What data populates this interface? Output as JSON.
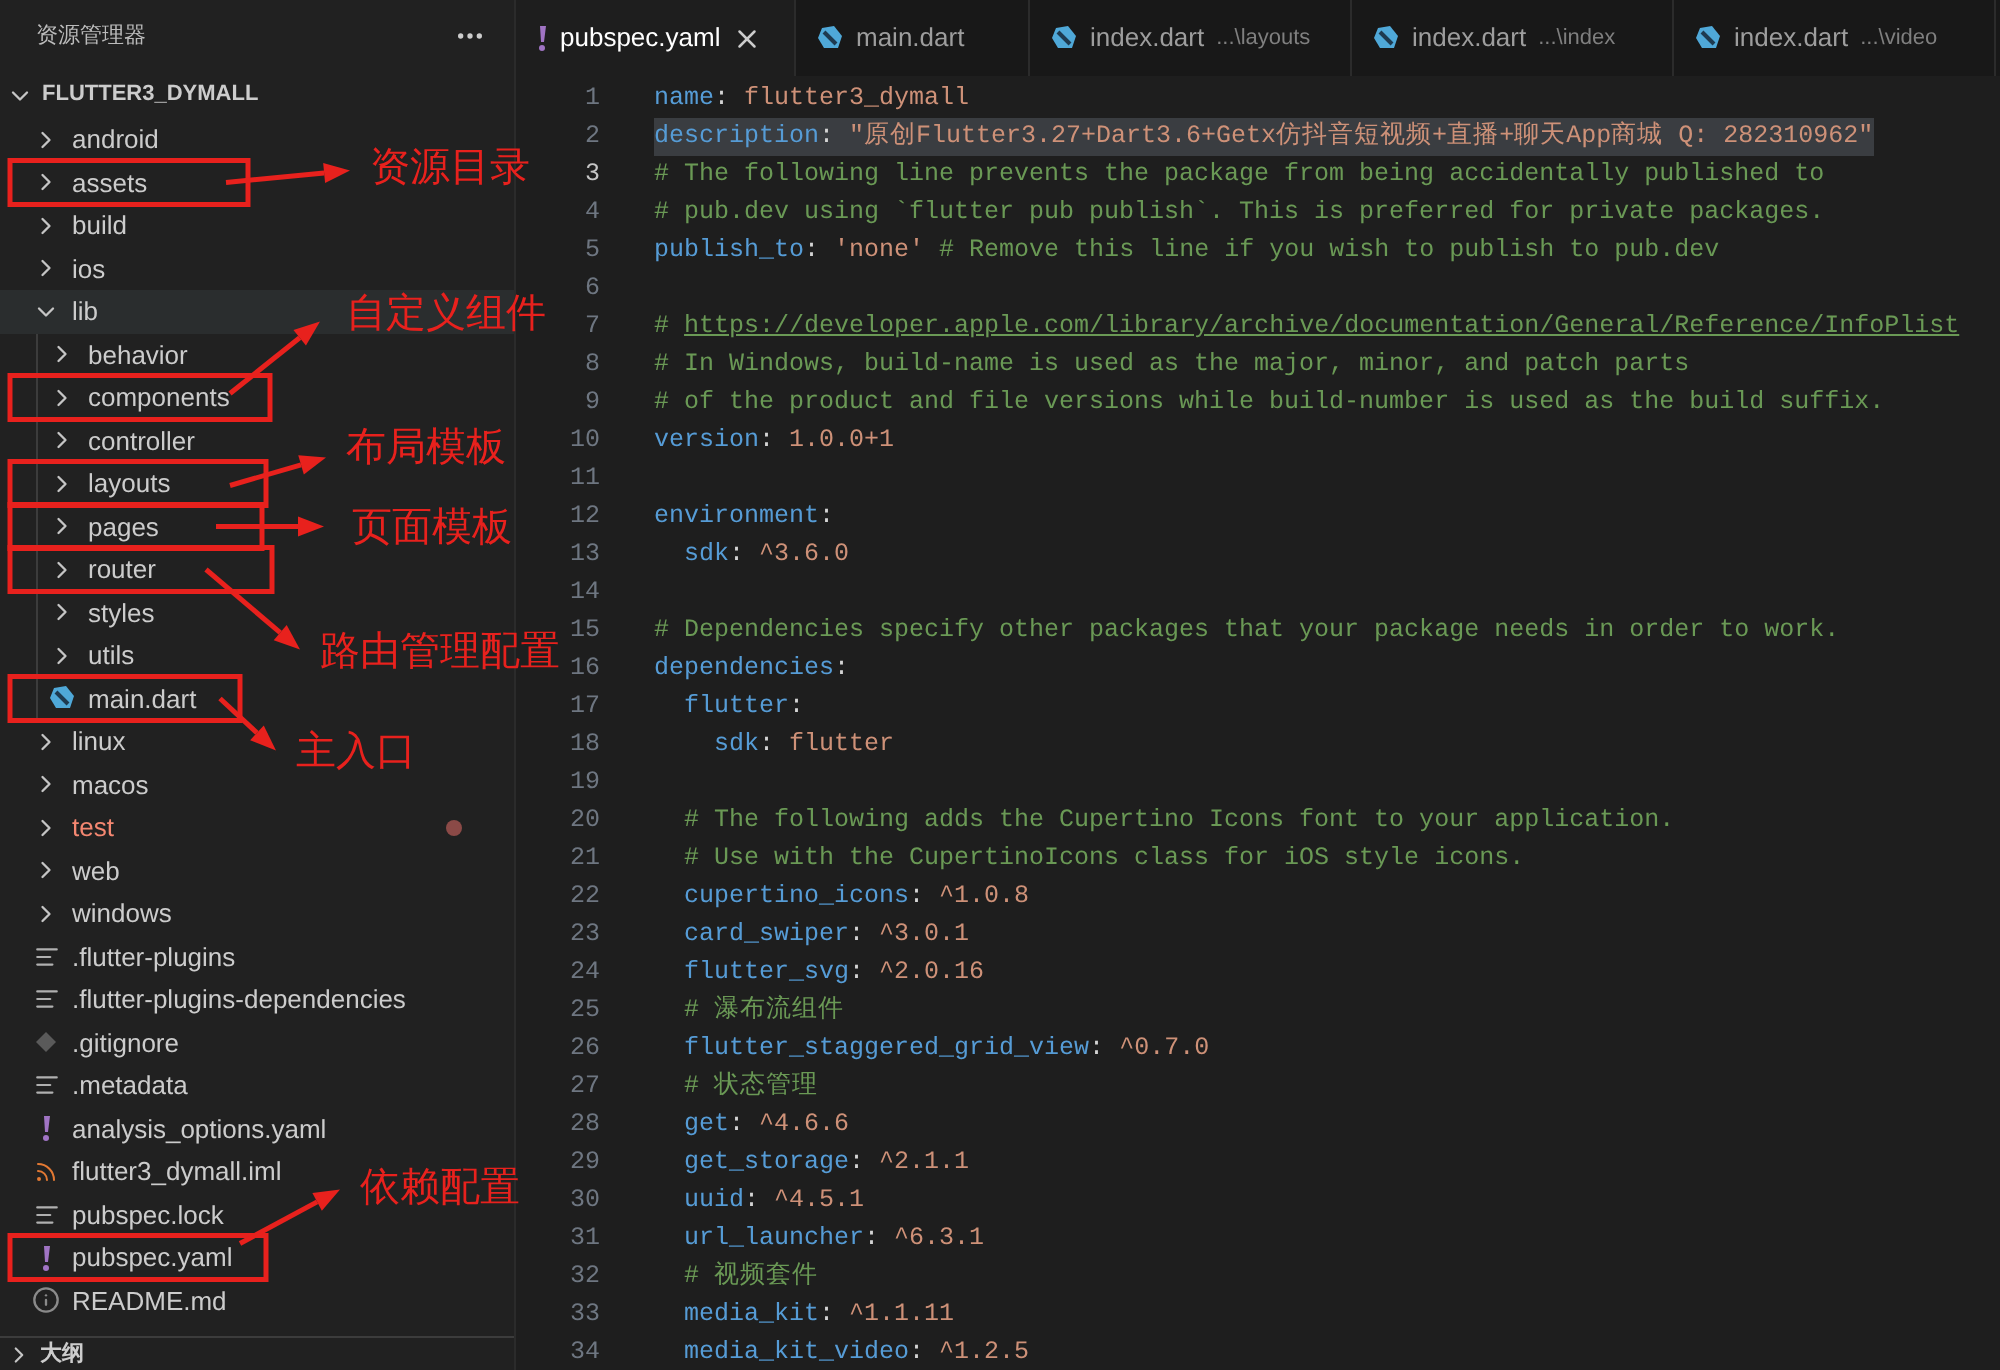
{
  "sidebar": {
    "title": "资源管理器",
    "project": {
      "name": "FLUTTER3_DYMALL",
      "expanded": true
    },
    "items": [
      {
        "name": "android",
        "kind": "folder",
        "expanded": false,
        "selected": false,
        "problem": false
      },
      {
        "name": "assets",
        "kind": "folder",
        "expanded": false,
        "selected": false,
        "problem": false
      },
      {
        "name": "build",
        "kind": "folder",
        "expanded": false,
        "selected": false,
        "problem": false
      },
      {
        "name": "ios",
        "kind": "folder",
        "expanded": false,
        "selected": false,
        "problem": false
      },
      {
        "name": "lib",
        "kind": "folder",
        "expanded": true,
        "selected": true,
        "problem": false,
        "children": [
          {
            "name": "behavior",
            "kind": "folder",
            "expanded": false,
            "selected": false,
            "problem": false
          },
          {
            "name": "components",
            "kind": "folder",
            "expanded": false,
            "selected": false,
            "problem": false
          },
          {
            "name": "controller",
            "kind": "folder",
            "expanded": false,
            "selected": false,
            "problem": false
          },
          {
            "name": "layouts",
            "kind": "folder",
            "expanded": false,
            "selected": false,
            "problem": false
          },
          {
            "name": "pages",
            "kind": "folder",
            "expanded": false,
            "selected": false,
            "problem": false
          },
          {
            "name": "router",
            "kind": "folder",
            "expanded": false,
            "selected": false,
            "problem": false
          },
          {
            "name": "styles",
            "kind": "folder",
            "expanded": false,
            "selected": false,
            "problem": false
          },
          {
            "name": "utils",
            "kind": "folder",
            "expanded": false,
            "selected": false,
            "problem": false
          },
          {
            "name": "main.dart",
            "kind": "dart",
            "selected": false,
            "problem": false
          }
        ]
      },
      {
        "name": "linux",
        "kind": "folder",
        "expanded": false,
        "selected": false,
        "problem": false
      },
      {
        "name": "macos",
        "kind": "folder",
        "expanded": false,
        "selected": false,
        "problem": false
      },
      {
        "name": "test",
        "kind": "folder",
        "expanded": false,
        "selected": false,
        "problem": true
      },
      {
        "name": "web",
        "kind": "folder",
        "expanded": false,
        "selected": false,
        "problem": false
      },
      {
        "name": "windows",
        "kind": "folder",
        "expanded": false,
        "selected": false,
        "problem": false
      },
      {
        "name": ".flutter-plugins",
        "kind": "text",
        "selected": false,
        "problem": false
      },
      {
        "name": ".flutter-plugins-dependencies",
        "kind": "text",
        "selected": false,
        "problem": false
      },
      {
        "name": ".gitignore",
        "kind": "git",
        "selected": false,
        "problem": false
      },
      {
        "name": ".metadata",
        "kind": "text",
        "selected": false,
        "problem": false
      },
      {
        "name": "analysis_options.yaml",
        "kind": "yaml",
        "selected": false,
        "problem": false
      },
      {
        "name": "flutter3_dymall.iml",
        "kind": "feed",
        "selected": false,
        "problem": false
      },
      {
        "name": "pubspec.lock",
        "kind": "text",
        "selected": false,
        "problem": false
      },
      {
        "name": "pubspec.yaml",
        "kind": "yaml",
        "selected": false,
        "problem": false
      },
      {
        "name": "README.md",
        "kind": "info",
        "selected": false,
        "problem": false
      }
    ],
    "outline": {
      "label": "大纲",
      "expanded": false
    }
  },
  "tabs": [
    {
      "label": "pubspec.yaml",
      "kind": "yaml",
      "selected": true
    },
    {
      "label": "main.dart",
      "kind": "dart",
      "selected": false
    },
    {
      "label": "index.dart",
      "path": "...\\layouts",
      "kind": "dart",
      "selected": false
    },
    {
      "label": "index.dart",
      "path": "...\\index",
      "kind": "dart",
      "selected": false
    },
    {
      "label": "index.dart",
      "path": "...\\video",
      "kind": "dart",
      "selected": false
    }
  ],
  "editor": {
    "lines": [
      {
        "no": "1",
        "highlighted": false,
        "current": false,
        "tokens": [
          {
            "kind": "key",
            "text": "name"
          },
          {
            "kind": "punct",
            "text": ": "
          },
          {
            "kind": "value",
            "text": "flutter3_dymall"
          }
        ]
      },
      {
        "no": "2",
        "highlighted": true,
        "current": false,
        "tokens": [
          {
            "kind": "key",
            "text": "description"
          },
          {
            "kind": "punct",
            "text": ": "
          },
          {
            "kind": "value",
            "text": "\"原创Flutter3.27+Dart3.6+Getx仿抖音短视频+直播+聊天App商城 Q: 282310962\""
          }
        ]
      },
      {
        "no": "3",
        "highlighted": false,
        "current": true,
        "tokens": [
          {
            "kind": "comment",
            "text": "# The following line prevents the package from being accidentally published to"
          }
        ]
      },
      {
        "no": "4",
        "highlighted": false,
        "current": false,
        "tokens": [
          {
            "kind": "comment",
            "text": "# pub.dev using `flutter pub publish`. This is preferred for private packages."
          }
        ]
      },
      {
        "no": "5",
        "highlighted": false,
        "current": false,
        "tokens": [
          {
            "kind": "key",
            "text": "publish_to"
          },
          {
            "kind": "punct",
            "text": ": "
          },
          {
            "kind": "value",
            "text": "'none'"
          },
          {
            "kind": "comment",
            "text": " # Remove this line if you wish to publish to pub.dev"
          }
        ]
      },
      {
        "no": "6",
        "highlighted": false,
        "current": false
      },
      {
        "no": "7",
        "highlighted": false,
        "current": false,
        "tokens": [
          {
            "kind": "comment",
            "text": "# "
          },
          {
            "kind": "link",
            "text": "https://developer.apple.com/library/archive/documentation/General/Reference/InfoPlist"
          }
        ]
      },
      {
        "no": "8",
        "highlighted": false,
        "current": false,
        "tokens": [
          {
            "kind": "comment",
            "text": "# In Windows, build-name is used as the major, minor, and patch parts"
          }
        ]
      },
      {
        "no": "9",
        "highlighted": false,
        "current": false,
        "tokens": [
          {
            "kind": "comment",
            "text": "# of the product and file versions while build-number is used as the build suffix."
          }
        ]
      },
      {
        "no": "10",
        "highlighted": false,
        "current": false,
        "tokens": [
          {
            "kind": "key",
            "text": "version"
          },
          {
            "kind": "punct",
            "text": ": "
          },
          {
            "kind": "value",
            "text": "1.0.0+1"
          }
        ]
      },
      {
        "no": "11",
        "highlighted": false,
        "current": false
      },
      {
        "no": "12",
        "highlighted": false,
        "current": false,
        "tokens": [
          {
            "kind": "key",
            "text": "environment"
          },
          {
            "kind": "punct",
            "text": ":"
          }
        ]
      },
      {
        "no": "13",
        "highlighted": false,
        "current": false,
        "tokens": [
          {
            "kind": "key",
            "text": "  sdk"
          },
          {
            "kind": "punct",
            "text": ": "
          },
          {
            "kind": "value",
            "text": "^3.6.0"
          }
        ]
      },
      {
        "no": "14",
        "highlighted": false,
        "current": false
      },
      {
        "no": "15",
        "highlighted": false,
        "current": false,
        "tokens": [
          {
            "kind": "comment",
            "text": "# Dependencies specify other packages that your package needs in order to work."
          }
        ]
      },
      {
        "no": "16",
        "highlighted": false,
        "current": false,
        "tokens": [
          {
            "kind": "key",
            "text": "dependencies"
          },
          {
            "kind": "punct",
            "text": ":"
          }
        ]
      },
      {
        "no": "17",
        "highlighted": false,
        "current": false,
        "tokens": [
          {
            "kind": "key",
            "text": "  flutter"
          },
          {
            "kind": "punct",
            "text": ":"
          }
        ]
      },
      {
        "no": "18",
        "highlighted": false,
        "current": false,
        "tokens": [
          {
            "kind": "key",
            "text": "    sdk"
          },
          {
            "kind": "punct",
            "text": ": "
          },
          {
            "kind": "value",
            "text": "flutter"
          }
        ]
      },
      {
        "no": "19",
        "highlighted": false,
        "current": false
      },
      {
        "no": "20",
        "highlighted": false,
        "current": false,
        "tokens": [
          {
            "kind": "comment",
            "text": "  # The following adds the Cupertino Icons font to your application."
          }
        ]
      },
      {
        "no": "21",
        "highlighted": false,
        "current": false,
        "tokens": [
          {
            "kind": "comment",
            "text": "  # Use with the CupertinoIcons class for iOS style icons."
          }
        ]
      },
      {
        "no": "22",
        "highlighted": false,
        "current": false,
        "tokens": [
          {
            "kind": "key",
            "text": "  cupertino_icons"
          },
          {
            "kind": "punct",
            "text": ": "
          },
          {
            "kind": "value",
            "text": "^1.0.8"
          }
        ]
      },
      {
        "no": "23",
        "highlighted": false,
        "current": false,
        "tokens": [
          {
            "kind": "key",
            "text": "  card_swiper"
          },
          {
            "kind": "punct",
            "text": ": "
          },
          {
            "kind": "value",
            "text": "^3.0.1"
          }
        ]
      },
      {
        "no": "24",
        "highlighted": false,
        "current": false,
        "tokens": [
          {
            "kind": "key",
            "text": "  flutter_svg"
          },
          {
            "kind": "punct",
            "text": ": "
          },
          {
            "kind": "value",
            "text": "^2.0.16"
          }
        ]
      },
      {
        "no": "25",
        "highlighted": false,
        "current": false,
        "tokens": [
          {
            "kind": "comment",
            "text": "  # 瀑布流组件"
          }
        ]
      },
      {
        "no": "26",
        "highlighted": false,
        "current": false,
        "tokens": [
          {
            "kind": "key",
            "text": "  flutter_staggered_grid_view"
          },
          {
            "kind": "punct",
            "text": ": "
          },
          {
            "kind": "value",
            "text": "^0.7.0"
          }
        ]
      },
      {
        "no": "27",
        "highlighted": false,
        "current": false,
        "tokens": [
          {
            "kind": "comment",
            "text": "  # 状态管理"
          }
        ]
      },
      {
        "no": "28",
        "highlighted": false,
        "current": false,
        "tokens": [
          {
            "kind": "key",
            "text": "  get"
          },
          {
            "kind": "punct",
            "text": ": "
          },
          {
            "kind": "value",
            "text": "^4.6.6"
          }
        ]
      },
      {
        "no": "29",
        "highlighted": false,
        "current": false,
        "tokens": [
          {
            "kind": "key",
            "text": "  get_storage"
          },
          {
            "kind": "punct",
            "text": ": "
          },
          {
            "kind": "value",
            "text": "^2.1.1"
          }
        ]
      },
      {
        "no": "30",
        "highlighted": false,
        "current": false,
        "tokens": [
          {
            "kind": "key",
            "text": "  uuid"
          },
          {
            "kind": "punct",
            "text": ": "
          },
          {
            "kind": "value",
            "text": "^4.5.1"
          }
        ]
      },
      {
        "no": "31",
        "highlighted": false,
        "current": false,
        "tokens": [
          {
            "kind": "key",
            "text": "  url_launcher"
          },
          {
            "kind": "punct",
            "text": ": "
          },
          {
            "kind": "value",
            "text": "^6.3.1"
          }
        ]
      },
      {
        "no": "32",
        "highlighted": false,
        "current": false,
        "tokens": [
          {
            "kind": "comment",
            "text": "  # 视频套件"
          }
        ]
      },
      {
        "no": "33",
        "highlighted": false,
        "current": false,
        "tokens": [
          {
            "kind": "key",
            "text": "  media_kit"
          },
          {
            "kind": "punct",
            "text": ": "
          },
          {
            "kind": "value",
            "text": "^1.1.11"
          }
        ]
      },
      {
        "no": "34",
        "highlighted": false,
        "current": false,
        "tokens": [
          {
            "kind": "key",
            "text": "  media_kit_video"
          },
          {
            "kind": "punct",
            "text": ": "
          },
          {
            "kind": "value",
            "text": "^1.2.5"
          }
        ]
      }
    ]
  },
  "annotations": [
    {
      "label": "资源目录"
    },
    {
      "label": "自定义组件"
    },
    {
      "label": "布局模板"
    },
    {
      "label": "页面模板"
    },
    {
      "label": "路由管理配置"
    },
    {
      "label": "主入口"
    },
    {
      "label": "依赖配置"
    }
  ]
}
